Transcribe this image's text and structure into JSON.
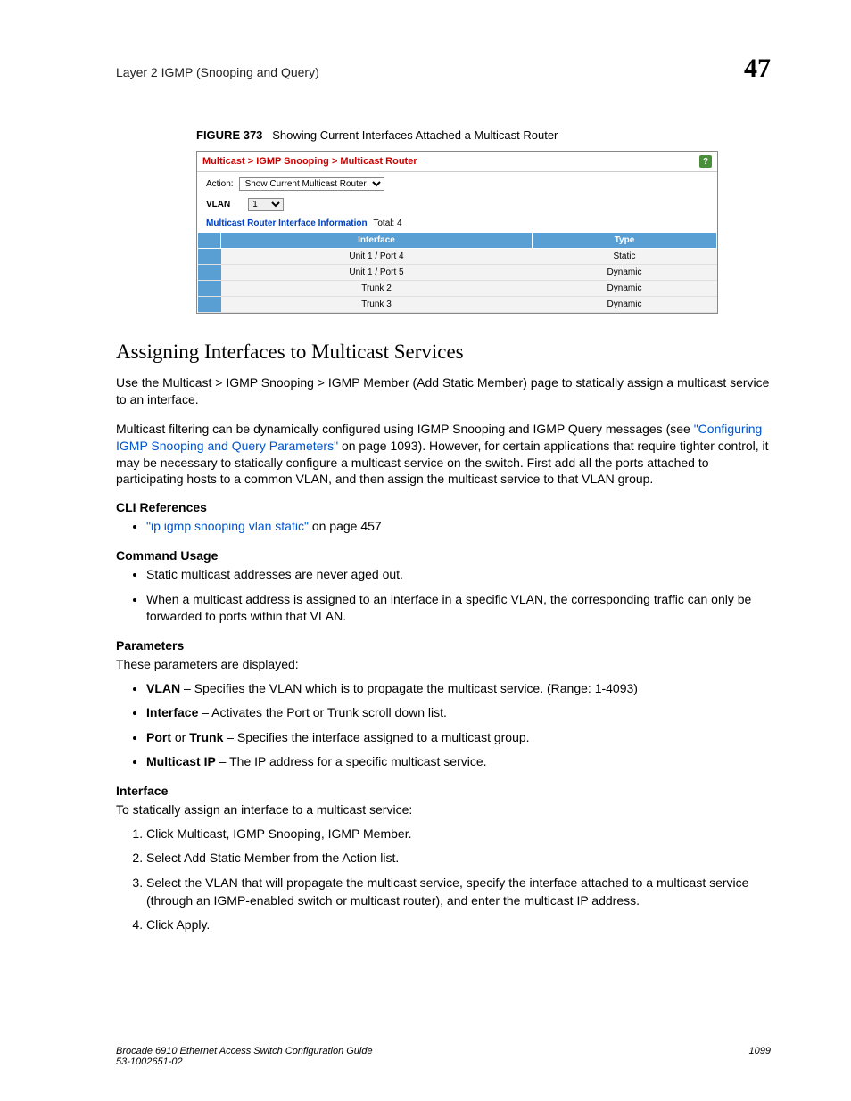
{
  "header": {
    "section": "Layer 2 IGMP (Snooping and Query)",
    "chapter": "47"
  },
  "figure": {
    "label": "FIGURE 373",
    "caption": "Showing Current Interfaces Attached a Multicast Router"
  },
  "screenshot": {
    "breadcrumb": "Multicast > IGMP Snooping > Multicast Router",
    "action_label": "Action:",
    "action_value": "Show Current Multicast Router",
    "vlan_label": "VLAN",
    "vlan_value": "1",
    "info_label": "Multicast Router Interface Information",
    "total_label": "Total:",
    "total_value": "4",
    "columns": {
      "c1": "Interface",
      "c2": "Type"
    },
    "rows": [
      {
        "iface": "Unit 1 / Port 4",
        "type": "Static"
      },
      {
        "iface": "Unit 1 / Port 5",
        "type": "Dynamic"
      },
      {
        "iface": "Trunk 2",
        "type": "Dynamic"
      },
      {
        "iface": "Trunk 3",
        "type": "Dynamic"
      }
    ]
  },
  "section_title": "Assigning Interfaces to Multicast Services",
  "para1": "Use the Multicast > IGMP Snooping > IGMP Member (Add Static Member) page to statically assign a multicast service to an interface.",
  "para2a": "Multicast filtering can be dynamically configured using IGMP Snooping and IGMP Query messages (see ",
  "para2_link": "\"Configuring IGMP Snooping and Query Parameters\"",
  "para2b": " on page 1093). However, for certain applications that require tighter control, it may be necessary to statically configure a multicast service on the switch. First add all the ports attached to participating hosts to a common VLAN, and then assign the multicast service to that VLAN group.",
  "cli_ref_head": "CLI References",
  "cli_ref_link": "\"ip igmp snooping vlan static\"",
  "cli_ref_tail": " on page 457",
  "cmd_usage_head": "Command Usage",
  "cmd_usage": [
    "Static multicast addresses are never aged out.",
    "When a multicast address is assigned to an interface in a specific VLAN, the corresponding traffic can only be forwarded to ports within that VLAN."
  ],
  "params_head": "Parameters",
  "params_intro": "These parameters are displayed:",
  "params": [
    {
      "term": "VLAN",
      "desc": " – Specifies the VLAN which is to propagate the multicast service. (Range: 1-4093)"
    },
    {
      "term": "Interface",
      "desc": " – Activates the Port or Trunk scroll down list."
    },
    {
      "term": "Port or Trunk",
      "desc": " – Specifies the interface assigned to a multicast group.",
      "term2": "Port",
      "or": " or ",
      "term3": "Trunk"
    },
    {
      "term": "Multicast IP",
      "desc": " – The IP address for a specific multicast service."
    }
  ],
  "iface_head": "Interface",
  "iface_intro": "To statically assign an interface to a multicast service:",
  "steps": [
    "Click Multicast, IGMP Snooping, IGMP Member.",
    "Select Add Static Member from the Action list.",
    "Select the VLAN that will propagate the multicast service, specify the interface attached to a multicast service (through an IGMP-enabled switch or multicast router), and enter the multicast IP address.",
    "Click Apply."
  ],
  "footer": {
    "title": "Brocade 6910 Ethernet Access Switch Configuration Guide",
    "docnum": "53-1002651-02",
    "page": "1099"
  }
}
